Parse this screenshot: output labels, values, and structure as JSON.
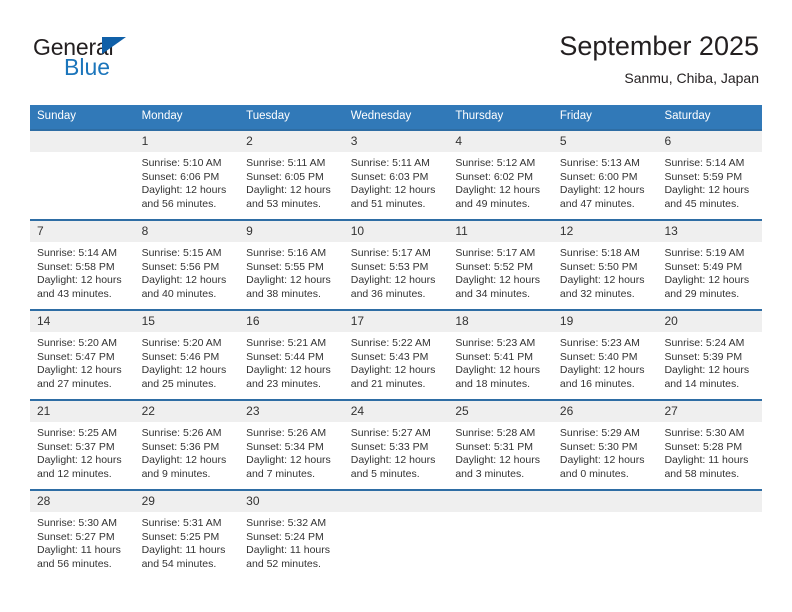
{
  "brand": {
    "name_part1": "General",
    "name_part2": "Blue",
    "triangle_color": "#1060a8",
    "blue_color": "#1b75bb"
  },
  "header": {
    "title": "September 2025",
    "subtitle": "Sanmu, Chiba, Japan"
  },
  "colors": {
    "header_band": "#3179b8",
    "week_divider": "#2e6da4",
    "daynum_band": "#efefef",
    "text": "#333333"
  },
  "weekdays": [
    "Sunday",
    "Monday",
    "Tuesday",
    "Wednesday",
    "Thursday",
    "Friday",
    "Saturday"
  ],
  "weeks": [
    [
      {
        "day": "",
        "sunrise": "",
        "sunset": "",
        "daylight1": "",
        "daylight2": ""
      },
      {
        "day": "1",
        "sunrise": "Sunrise: 5:10 AM",
        "sunset": "Sunset: 6:06 PM",
        "daylight1": "Daylight: 12 hours",
        "daylight2": "and 56 minutes."
      },
      {
        "day": "2",
        "sunrise": "Sunrise: 5:11 AM",
        "sunset": "Sunset: 6:05 PM",
        "daylight1": "Daylight: 12 hours",
        "daylight2": "and 53 minutes."
      },
      {
        "day": "3",
        "sunrise": "Sunrise: 5:11 AM",
        "sunset": "Sunset: 6:03 PM",
        "daylight1": "Daylight: 12 hours",
        "daylight2": "and 51 minutes."
      },
      {
        "day": "4",
        "sunrise": "Sunrise: 5:12 AM",
        "sunset": "Sunset: 6:02 PM",
        "daylight1": "Daylight: 12 hours",
        "daylight2": "and 49 minutes."
      },
      {
        "day": "5",
        "sunrise": "Sunrise: 5:13 AM",
        "sunset": "Sunset: 6:00 PM",
        "daylight1": "Daylight: 12 hours",
        "daylight2": "and 47 minutes."
      },
      {
        "day": "6",
        "sunrise": "Sunrise: 5:14 AM",
        "sunset": "Sunset: 5:59 PM",
        "daylight1": "Daylight: 12 hours",
        "daylight2": "and 45 minutes."
      }
    ],
    [
      {
        "day": "7",
        "sunrise": "Sunrise: 5:14 AM",
        "sunset": "Sunset: 5:58 PM",
        "daylight1": "Daylight: 12 hours",
        "daylight2": "and 43 minutes."
      },
      {
        "day": "8",
        "sunrise": "Sunrise: 5:15 AM",
        "sunset": "Sunset: 5:56 PM",
        "daylight1": "Daylight: 12 hours",
        "daylight2": "and 40 minutes."
      },
      {
        "day": "9",
        "sunrise": "Sunrise: 5:16 AM",
        "sunset": "Sunset: 5:55 PM",
        "daylight1": "Daylight: 12 hours",
        "daylight2": "and 38 minutes."
      },
      {
        "day": "10",
        "sunrise": "Sunrise: 5:17 AM",
        "sunset": "Sunset: 5:53 PM",
        "daylight1": "Daylight: 12 hours",
        "daylight2": "and 36 minutes."
      },
      {
        "day": "11",
        "sunrise": "Sunrise: 5:17 AM",
        "sunset": "Sunset: 5:52 PM",
        "daylight1": "Daylight: 12 hours",
        "daylight2": "and 34 minutes."
      },
      {
        "day": "12",
        "sunrise": "Sunrise: 5:18 AM",
        "sunset": "Sunset: 5:50 PM",
        "daylight1": "Daylight: 12 hours",
        "daylight2": "and 32 minutes."
      },
      {
        "day": "13",
        "sunrise": "Sunrise: 5:19 AM",
        "sunset": "Sunset: 5:49 PM",
        "daylight1": "Daylight: 12 hours",
        "daylight2": "and 29 minutes."
      }
    ],
    [
      {
        "day": "14",
        "sunrise": "Sunrise: 5:20 AM",
        "sunset": "Sunset: 5:47 PM",
        "daylight1": "Daylight: 12 hours",
        "daylight2": "and 27 minutes."
      },
      {
        "day": "15",
        "sunrise": "Sunrise: 5:20 AM",
        "sunset": "Sunset: 5:46 PM",
        "daylight1": "Daylight: 12 hours",
        "daylight2": "and 25 minutes."
      },
      {
        "day": "16",
        "sunrise": "Sunrise: 5:21 AM",
        "sunset": "Sunset: 5:44 PM",
        "daylight1": "Daylight: 12 hours",
        "daylight2": "and 23 minutes."
      },
      {
        "day": "17",
        "sunrise": "Sunrise: 5:22 AM",
        "sunset": "Sunset: 5:43 PM",
        "daylight1": "Daylight: 12 hours",
        "daylight2": "and 21 minutes."
      },
      {
        "day": "18",
        "sunrise": "Sunrise: 5:23 AM",
        "sunset": "Sunset: 5:41 PM",
        "daylight1": "Daylight: 12 hours",
        "daylight2": "and 18 minutes."
      },
      {
        "day": "19",
        "sunrise": "Sunrise: 5:23 AM",
        "sunset": "Sunset: 5:40 PM",
        "daylight1": "Daylight: 12 hours",
        "daylight2": "and 16 minutes."
      },
      {
        "day": "20",
        "sunrise": "Sunrise: 5:24 AM",
        "sunset": "Sunset: 5:39 PM",
        "daylight1": "Daylight: 12 hours",
        "daylight2": "and 14 minutes."
      }
    ],
    [
      {
        "day": "21",
        "sunrise": "Sunrise: 5:25 AM",
        "sunset": "Sunset: 5:37 PM",
        "daylight1": "Daylight: 12 hours",
        "daylight2": "and 12 minutes."
      },
      {
        "day": "22",
        "sunrise": "Sunrise: 5:26 AM",
        "sunset": "Sunset: 5:36 PM",
        "daylight1": "Daylight: 12 hours",
        "daylight2": "and 9 minutes."
      },
      {
        "day": "23",
        "sunrise": "Sunrise: 5:26 AM",
        "sunset": "Sunset: 5:34 PM",
        "daylight1": "Daylight: 12 hours",
        "daylight2": "and 7 minutes."
      },
      {
        "day": "24",
        "sunrise": "Sunrise: 5:27 AM",
        "sunset": "Sunset: 5:33 PM",
        "daylight1": "Daylight: 12 hours",
        "daylight2": "and 5 minutes."
      },
      {
        "day": "25",
        "sunrise": "Sunrise: 5:28 AM",
        "sunset": "Sunset: 5:31 PM",
        "daylight1": "Daylight: 12 hours",
        "daylight2": "and 3 minutes."
      },
      {
        "day": "26",
        "sunrise": "Sunrise: 5:29 AM",
        "sunset": "Sunset: 5:30 PM",
        "daylight1": "Daylight: 12 hours",
        "daylight2": "and 0 minutes."
      },
      {
        "day": "27",
        "sunrise": "Sunrise: 5:30 AM",
        "sunset": "Sunset: 5:28 PM",
        "daylight1": "Daylight: 11 hours",
        "daylight2": "and 58 minutes."
      }
    ],
    [
      {
        "day": "28",
        "sunrise": "Sunrise: 5:30 AM",
        "sunset": "Sunset: 5:27 PM",
        "daylight1": "Daylight: 11 hours",
        "daylight2": "and 56 minutes."
      },
      {
        "day": "29",
        "sunrise": "Sunrise: 5:31 AM",
        "sunset": "Sunset: 5:25 PM",
        "daylight1": "Daylight: 11 hours",
        "daylight2": "and 54 minutes."
      },
      {
        "day": "30",
        "sunrise": "Sunrise: 5:32 AM",
        "sunset": "Sunset: 5:24 PM",
        "daylight1": "Daylight: 11 hours",
        "daylight2": "and 52 minutes."
      },
      {
        "day": "",
        "sunrise": "",
        "sunset": "",
        "daylight1": "",
        "daylight2": ""
      },
      {
        "day": "",
        "sunrise": "",
        "sunset": "",
        "daylight1": "",
        "daylight2": ""
      },
      {
        "day": "",
        "sunrise": "",
        "sunset": "",
        "daylight1": "",
        "daylight2": ""
      },
      {
        "day": "",
        "sunrise": "",
        "sunset": "",
        "daylight1": "",
        "daylight2": ""
      }
    ]
  ]
}
